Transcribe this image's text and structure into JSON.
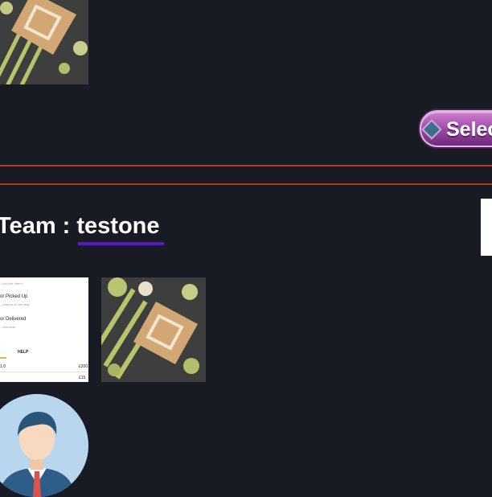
{
  "select_button": {
    "label": "Select"
  },
  "team": {
    "prefix": "Team :",
    "name": "testone"
  },
  "app_thumbnail": {
    "line_faded": "...d in the rider's",
    "step_picked_up": "or Picked Up",
    "step_picked_up_sub": "...ptain is on the way",
    "step_delivered": "or Delivered",
    "step_delivered_sub": "...our meal",
    "help_label": "HELP",
    "left_value": "1.0",
    "right_value": "£200",
    "bottom_value": "£15"
  },
  "icons": [
    "pattern-thumbnail",
    "select-gem-icon",
    "user-avatar-icon"
  ],
  "colors": {
    "background": "#181a24",
    "divider": "#b43a22",
    "underline": "#5a18c9",
    "button": "#9a47a2"
  }
}
